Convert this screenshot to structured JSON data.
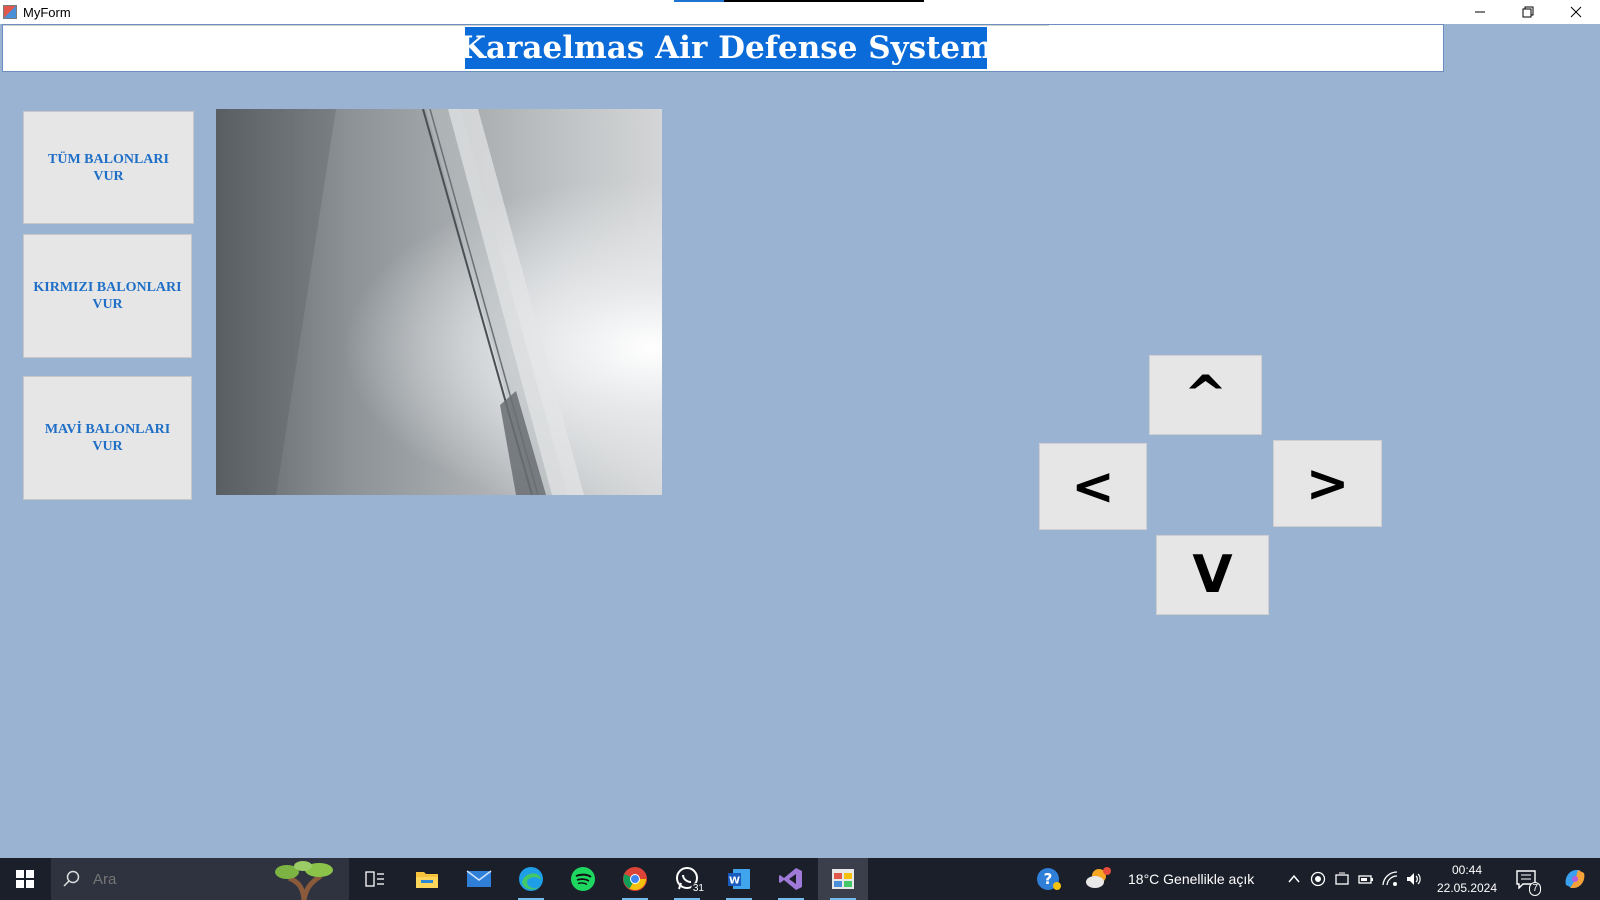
{
  "window": {
    "title": "MyForm",
    "minimize_icon": "minimize-icon",
    "restore_icon": "restore-icon",
    "close_icon": "close-icon"
  },
  "header": {
    "title": "Karaelmas Air Defense System"
  },
  "buttons": {
    "all_balloons": "TÜM BALONLARI VUR",
    "red_balloons": "KIRMIZI BALONLARI VUR",
    "blue_balloons": "MAVİ BALONLARI VUR"
  },
  "camera": {
    "icon": "camera-feed"
  },
  "arrows": {
    "up": "^",
    "left": "<",
    "right": ">",
    "down": "V"
  },
  "taskbar": {
    "search_placeholder": "Ara",
    "apps": [
      "task-view-icon",
      "file-explorer-icon",
      "mail-icon",
      "edge-icon",
      "spotify-icon",
      "chrome-icon",
      "whatsapp-icon",
      "word-icon",
      "visual-studio-icon",
      "myform-app-icon"
    ],
    "whatsapp_badge": "31",
    "weather": "18°C  Genellikle açık",
    "time": "00:44",
    "date": "22.05.2024",
    "notification_count": "7"
  },
  "colors": {
    "form_background": "#9bb3d3",
    "title_highlight": "#0a6bd9",
    "button_text": "#1f6fc7",
    "taskbar": "#1b1f2a"
  }
}
